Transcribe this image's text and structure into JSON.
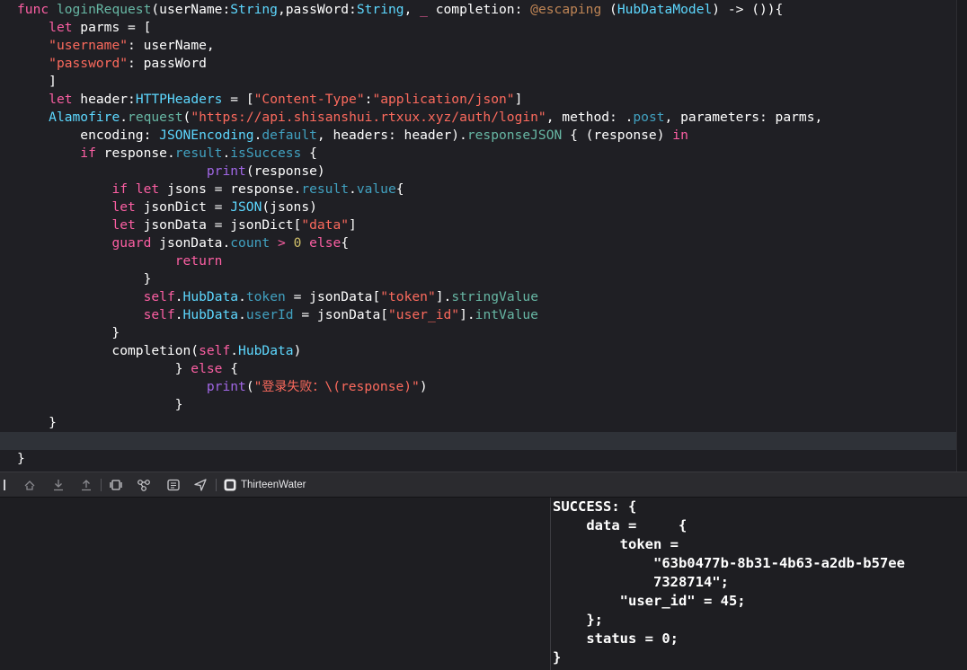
{
  "editor": {
    "lines": [
      [
        [
          "kw",
          "func "
        ],
        [
          "fn",
          "loginRequest"
        ],
        [
          "",
          "(userName:"
        ],
        [
          "ty",
          "String"
        ],
        [
          "",
          ",passWord:"
        ],
        [
          "ty",
          "String"
        ],
        [
          "",
          ", "
        ],
        [
          "kw",
          "_"
        ],
        [
          "",
          " completion: "
        ],
        [
          "atr",
          "@escaping"
        ],
        [
          "",
          " ("
        ],
        [
          "ty",
          "HubDataModel"
        ],
        [
          "",
          ") -> ()){"
        ]
      ],
      [
        [
          "",
          "    "
        ],
        [
          "kw",
          "let"
        ],
        [
          "",
          " parms = ["
        ]
      ],
      [
        [
          "",
          "    "
        ],
        [
          "st",
          "\"username\""
        ],
        [
          "",
          ": userName,"
        ]
      ],
      [
        [
          "",
          "    "
        ],
        [
          "st",
          "\"password\""
        ],
        [
          "",
          ": passWord"
        ]
      ],
      [
        [
          "",
          "    ]"
        ]
      ],
      [
        [
          "",
          "    "
        ],
        [
          "kw",
          "let"
        ],
        [
          "",
          " header:"
        ],
        [
          "ty",
          "HTTPHeaders"
        ],
        [
          "",
          " = ["
        ],
        [
          "st",
          "\"Content-Type\""
        ],
        [
          "",
          ":"
        ],
        [
          "st",
          "\"application/json\""
        ],
        [
          "",
          "]"
        ]
      ],
      [
        [
          "",
          "    "
        ],
        [
          "ty",
          "Alamofire"
        ],
        [
          "",
          "."
        ],
        [
          "fn",
          "request"
        ],
        [
          "",
          "("
        ],
        [
          "st",
          "\"https://api.shisanshui.rtxux.xyz/auth/login\""
        ],
        [
          "",
          ", method: ."
        ],
        [
          "mb",
          "post"
        ],
        [
          "",
          ", parameters: parms,"
        ]
      ],
      [
        [
          "",
          "        encoding: "
        ],
        [
          "ty",
          "JSONEncoding"
        ],
        [
          "",
          "."
        ],
        [
          "mb",
          "default"
        ],
        [
          "",
          ", headers: header)."
        ],
        [
          "fn",
          "responseJSON"
        ],
        [
          "",
          " { (response) "
        ],
        [
          "kw",
          "in"
        ]
      ],
      [
        [
          "",
          "        "
        ],
        [
          "kw",
          "if"
        ],
        [
          "",
          " response."
        ],
        [
          "mb",
          "result"
        ],
        [
          "",
          "."
        ],
        [
          "mb",
          "isSuccess"
        ],
        [
          "",
          " {"
        ]
      ],
      [
        [
          "",
          "                        "
        ],
        [
          "pr",
          "print"
        ],
        [
          "",
          "(response)"
        ]
      ],
      [
        [
          "",
          "            "
        ],
        [
          "kw",
          "if let"
        ],
        [
          "",
          " jsons = response."
        ],
        [
          "mb",
          "result"
        ],
        [
          "",
          "."
        ],
        [
          "mb",
          "value"
        ],
        [
          "",
          "{"
        ]
      ],
      [
        [
          "",
          "            "
        ],
        [
          "kw",
          "let"
        ],
        [
          "",
          " jsonDict = "
        ],
        [
          "ty",
          "JSON"
        ],
        [
          "",
          "(jsons)"
        ]
      ],
      [
        [
          "",
          "            "
        ],
        [
          "kw",
          "let"
        ],
        [
          "",
          " jsonData = jsonDict["
        ],
        [
          "st",
          "\"data\""
        ],
        [
          "",
          "]"
        ]
      ],
      [
        [
          "",
          "            "
        ],
        [
          "kw",
          "guard"
        ],
        [
          "",
          " jsonData."
        ],
        [
          "mb",
          "count"
        ],
        [
          "",
          " "
        ],
        [
          "kw",
          ">"
        ],
        [
          "",
          " "
        ],
        [
          "nm",
          "0"
        ],
        [
          "",
          " "
        ],
        [
          "kw",
          "else"
        ],
        [
          "",
          "{"
        ]
      ],
      [
        [
          "",
          "                    "
        ],
        [
          "kw",
          "return"
        ]
      ],
      [
        [
          "",
          "                }"
        ]
      ],
      [
        [
          "",
          "                "
        ],
        [
          "kw",
          "self"
        ],
        [
          "",
          "."
        ],
        [
          "ty",
          "HubData"
        ],
        [
          "",
          "."
        ],
        [
          "mb",
          "token"
        ],
        [
          "",
          " = jsonData["
        ],
        [
          "st",
          "\"token\""
        ],
        [
          "",
          "]."
        ],
        [
          "fn",
          "stringValue"
        ]
      ],
      [
        [
          "",
          "                "
        ],
        [
          "kw",
          "self"
        ],
        [
          "",
          "."
        ],
        [
          "ty",
          "HubData"
        ],
        [
          "",
          "."
        ],
        [
          "mb",
          "userId"
        ],
        [
          "",
          " = jsonData["
        ],
        [
          "st",
          "\"user_id\""
        ],
        [
          "",
          "]."
        ],
        [
          "fn",
          "intValue"
        ]
      ],
      [
        [
          "",
          "            }"
        ]
      ],
      [
        [
          "",
          "            completion("
        ],
        [
          "kw",
          "self"
        ],
        [
          "",
          "."
        ],
        [
          "ty",
          "HubData"
        ],
        [
          "",
          ")"
        ]
      ],
      [
        [
          "",
          "                    } "
        ],
        [
          "kw",
          "else"
        ],
        [
          "",
          " {"
        ]
      ],
      [
        [
          "",
          "                        "
        ],
        [
          "pr",
          "print"
        ],
        [
          "",
          "("
        ],
        [
          "st",
          "\""
        ],
        [
          "stcn",
          "登录失败："
        ],
        [
          "st",
          "\\(response)\""
        ],
        [
          "",
          ")"
        ]
      ],
      [
        [
          "",
          "                    }"
        ]
      ],
      [
        [
          "",
          "    }"
        ]
      ],
      [
        [
          "",
          ""
        ]
      ],
      [
        [
          "",
          "}"
        ]
      ]
    ],
    "active_line_index": 24
  },
  "debug_bar": {
    "scheme_name": "ThirteenWater",
    "icons": [
      "sidebar-toggle-icon",
      "continue-icon",
      "step-over-icon",
      "step-out-icon",
      "view-hierarchy-icon",
      "memory-graph-icon",
      "environment-icon",
      "location-icon",
      "app-icon"
    ]
  },
  "console": {
    "lines": [
      "SUCCESS: {",
      "    data =     {",
      "        token =",
      "            \"63b0477b-8b31-4b63-a2db-b57ee",
      "            7328714\";",
      "        \"user_id\" = 45;",
      "    };",
      "    status = 0;",
      "}"
    ]
  }
}
